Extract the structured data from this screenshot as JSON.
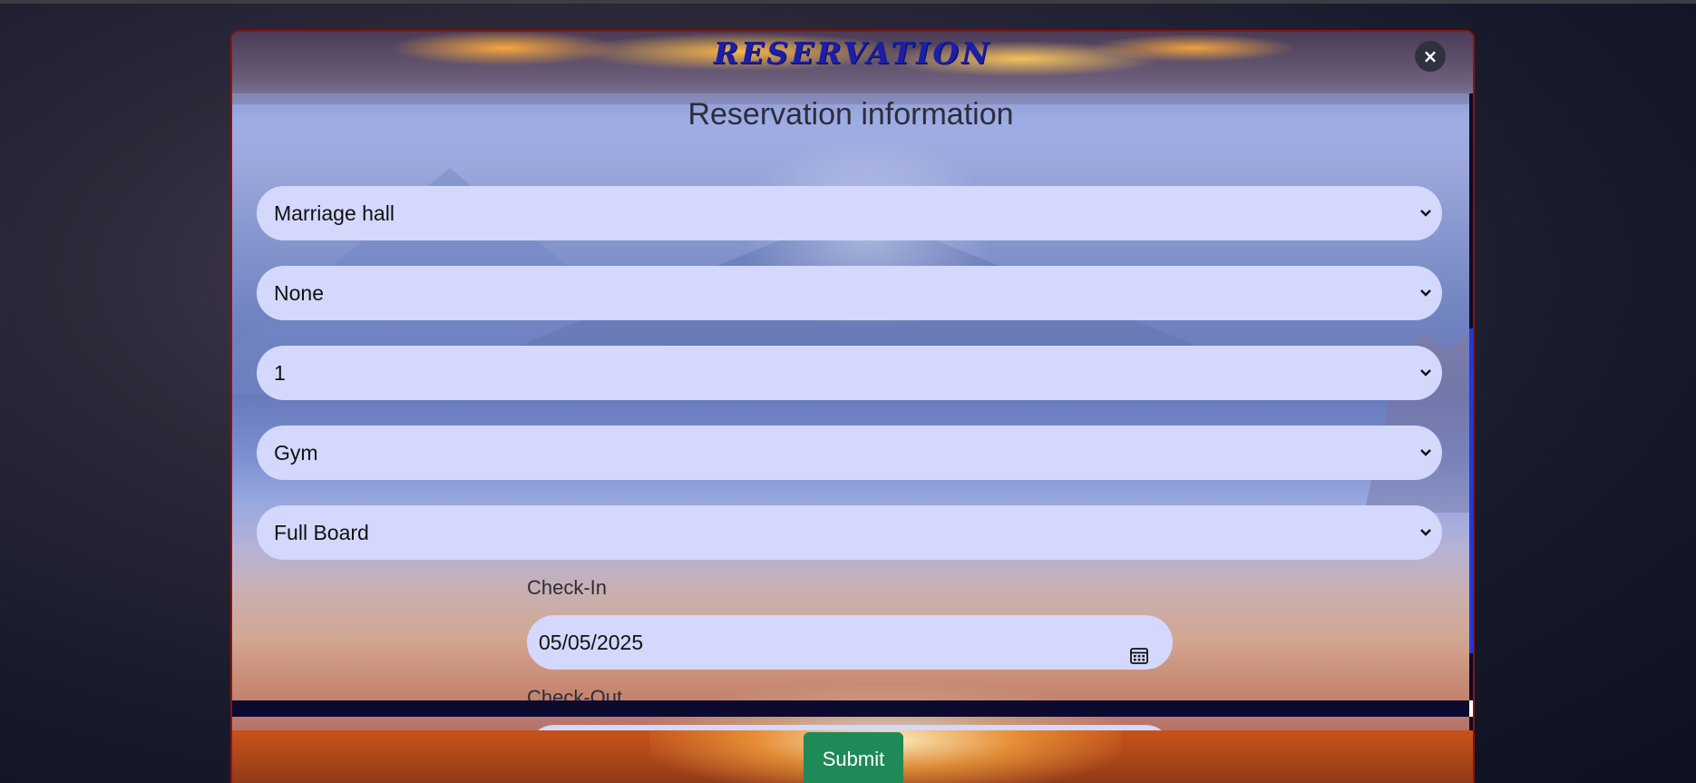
{
  "modal": {
    "title": "RESERVATION",
    "close_icon": "close-icon",
    "close_label": "×"
  },
  "form": {
    "section_title": "Reservation information",
    "selects": [
      {
        "value": "Marriage hall"
      },
      {
        "value": "None"
      },
      {
        "value": "1"
      },
      {
        "value": "Gym"
      },
      {
        "value": "Full Board"
      }
    ],
    "check_in_label": "Check-In",
    "check_in_value": "05/05/2025",
    "check_out_label": "Check-Out",
    "submit_label": "Submit"
  },
  "colors": {
    "title": "#1b1fa8",
    "field_bg": "#d4d8fc",
    "submit_bg": "#1f8a58",
    "modal_border": "#8a1410",
    "scroll_thumb": "#1f3ae0"
  }
}
